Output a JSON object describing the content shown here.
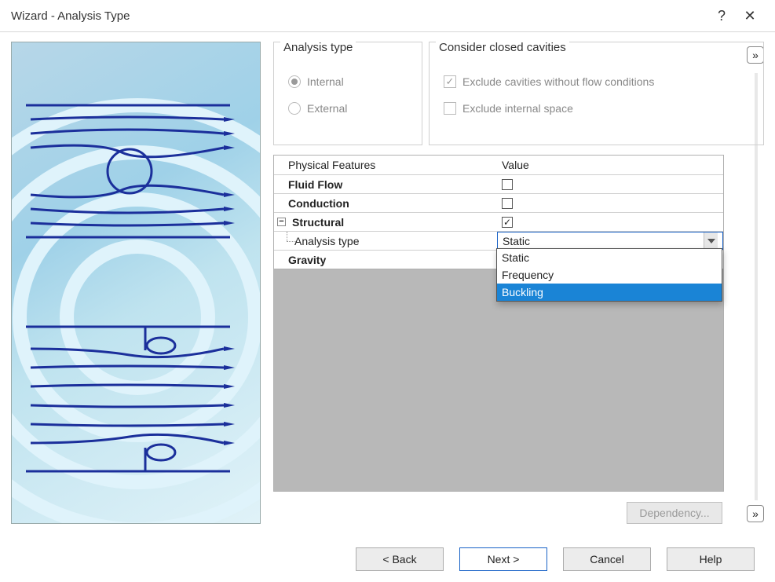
{
  "window": {
    "title": "Wizard - Analysis Type"
  },
  "groups": {
    "analysis_type": {
      "title": "Analysis type",
      "options": {
        "internal": "Internal",
        "external": "External"
      },
      "selected": "internal"
    },
    "cavities": {
      "title": "Consider closed cavities",
      "exclude_flow": {
        "label": "Exclude cavities without flow conditions",
        "checked": true
      },
      "exclude_internal": {
        "label": "Exclude internal space",
        "checked": false
      }
    }
  },
  "table": {
    "headers": {
      "col1": "Physical Features",
      "col2": "Value"
    },
    "fluid_flow": {
      "label": "Fluid Flow",
      "checked": false
    },
    "conduction": {
      "label": "Conduction",
      "checked": false
    },
    "structural": {
      "label": "Structural",
      "checked": true,
      "expanded": true
    },
    "structural_child": {
      "label": "Analysis type",
      "value": "Static",
      "options": [
        "Static",
        "Frequency",
        "Buckling"
      ],
      "highlighted": "Buckling"
    },
    "gravity": {
      "label": "Gravity"
    }
  },
  "buttons": {
    "dependency": "Dependency...",
    "back": "< Back",
    "next": "Next >",
    "cancel": "Cancel",
    "help": "Help"
  },
  "titlebar": {
    "help_glyph": "?",
    "close_glyph": "✕"
  },
  "expander_glyph": "»"
}
